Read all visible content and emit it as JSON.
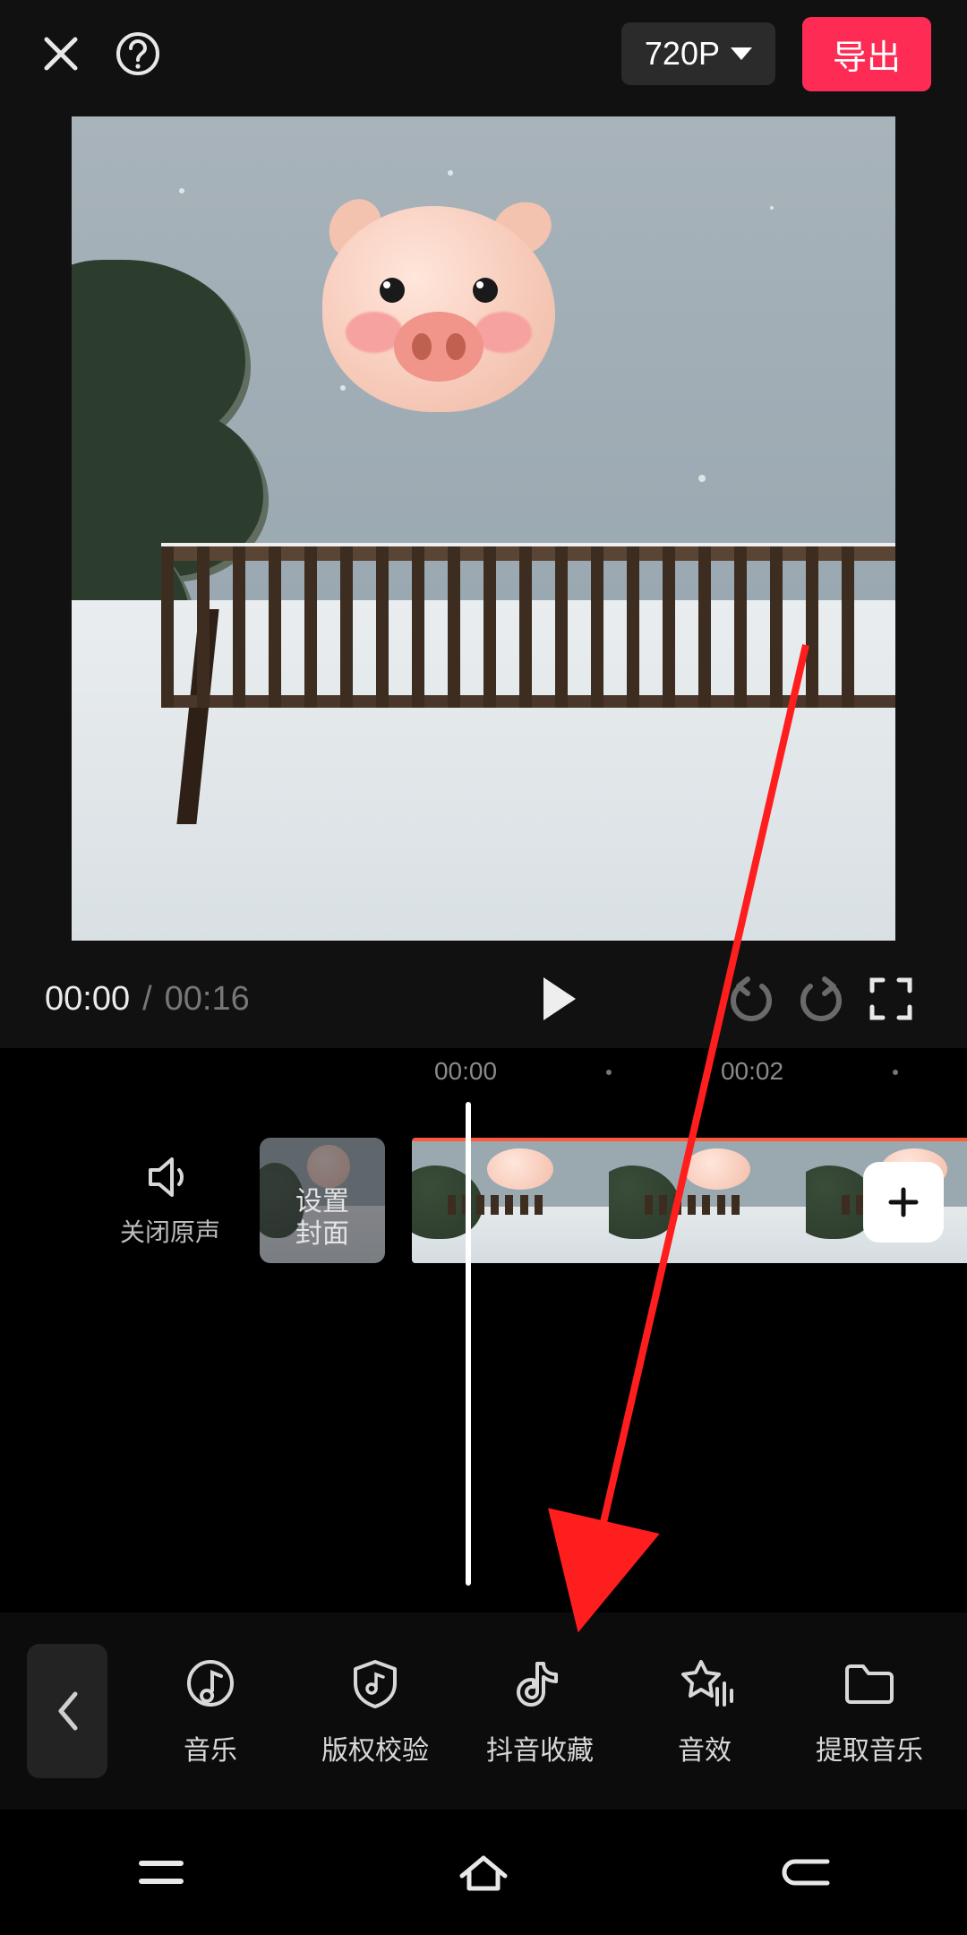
{
  "header": {
    "resolution_label": "720P",
    "export_label": "导出"
  },
  "playback": {
    "current_time": "00:00",
    "separator": "/",
    "total_time": "00:16"
  },
  "ruler": {
    "ticks": [
      "00:00",
      "00:02"
    ]
  },
  "timeline": {
    "mute_label": "关闭原声",
    "cover_label_line1": "设置",
    "cover_label_line2": "封面"
  },
  "toolbar": {
    "items": [
      {
        "key": "music",
        "label": "音乐"
      },
      {
        "key": "verify",
        "label": "版权校验"
      },
      {
        "key": "douyin",
        "label": "抖音收藏"
      },
      {
        "key": "sfx",
        "label": "音效"
      },
      {
        "key": "extract",
        "label": "提取音乐"
      }
    ]
  }
}
